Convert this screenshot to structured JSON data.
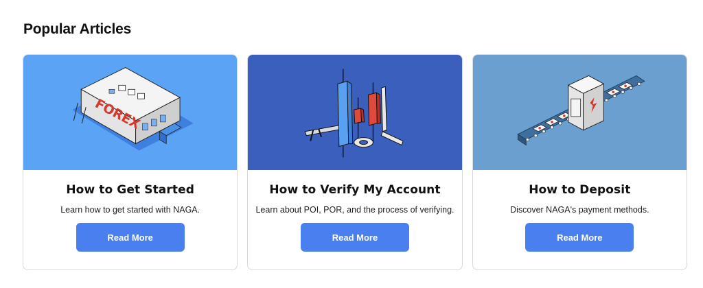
{
  "section": {
    "title": "Popular Articles"
  },
  "cards": [
    {
      "title": "How to Get Started",
      "description": "Learn how to get started with NAGA.",
      "button_label": "Read More",
      "image_bg": "#5ba3f5",
      "image_icon": "forex-building-illustration",
      "image_text": "FOREX"
    },
    {
      "title": "How to Verify My Account",
      "description": "Learn about POI, POR, and the process of verifying.",
      "button_label": "Read More",
      "image_bg": "#3a5fbd",
      "image_icon": "candlestick-ruler-illustration"
    },
    {
      "title": "How to Deposit",
      "description": "Discover NAGA's payment methods.",
      "button_label": "Read More",
      "image_bg": "#6b9fd0",
      "image_icon": "payment-conveyor-illustration"
    }
  ],
  "colors": {
    "button": "#4a7ff0",
    "card_border": "#d6d9de"
  }
}
